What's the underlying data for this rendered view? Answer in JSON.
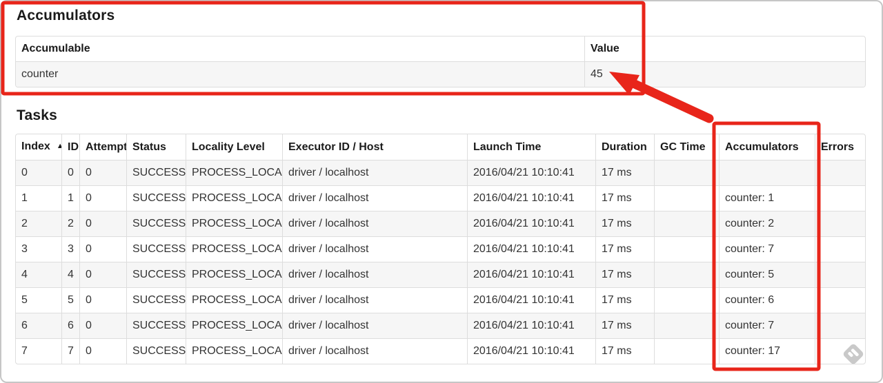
{
  "accumulators_section": {
    "title": "Accumulators",
    "table": {
      "headers": [
        "Accumulable",
        "Value"
      ],
      "rows": [
        {
          "accumulable": "counter",
          "value": "45"
        }
      ]
    }
  },
  "tasks_section": {
    "title": "Tasks",
    "table": {
      "headers": [
        "Index",
        "ID",
        "Attempt",
        "Status",
        "Locality Level",
        "Executor ID / Host",
        "Launch Time",
        "Duration",
        "GC Time",
        "Accumulators",
        "Errors"
      ],
      "sort_column": "Index",
      "sort_icon": "▲",
      "rows": [
        {
          "index": "0",
          "id": "0",
          "attempt": "0",
          "status": "SUCCESS",
          "locality_level": "PROCESS_LOCAL",
          "executor_id_host": "driver / localhost",
          "launch_time": "2016/04/21 10:10:41",
          "duration": "17 ms",
          "gc_time": "",
          "accumulators": "",
          "errors": ""
        },
        {
          "index": "1",
          "id": "1",
          "attempt": "0",
          "status": "SUCCESS",
          "locality_level": "PROCESS_LOCAL",
          "executor_id_host": "driver / localhost",
          "launch_time": "2016/04/21 10:10:41",
          "duration": "17 ms",
          "gc_time": "",
          "accumulators": "counter: 1",
          "errors": ""
        },
        {
          "index": "2",
          "id": "2",
          "attempt": "0",
          "status": "SUCCESS",
          "locality_level": "PROCESS_LOCAL",
          "executor_id_host": "driver / localhost",
          "launch_time": "2016/04/21 10:10:41",
          "duration": "17 ms",
          "gc_time": "",
          "accumulators": "counter: 2",
          "errors": ""
        },
        {
          "index": "3",
          "id": "3",
          "attempt": "0",
          "status": "SUCCESS",
          "locality_level": "PROCESS_LOCAL",
          "executor_id_host": "driver / localhost",
          "launch_time": "2016/04/21 10:10:41",
          "duration": "17 ms",
          "gc_time": "",
          "accumulators": "counter: 7",
          "errors": ""
        },
        {
          "index": "4",
          "id": "4",
          "attempt": "0",
          "status": "SUCCESS",
          "locality_level": "PROCESS_LOCAL",
          "executor_id_host": "driver / localhost",
          "launch_time": "2016/04/21 10:10:41",
          "duration": "17 ms",
          "gc_time": "",
          "accumulators": "counter: 5",
          "errors": ""
        },
        {
          "index": "5",
          "id": "5",
          "attempt": "0",
          "status": "SUCCESS",
          "locality_level": "PROCESS_LOCAL",
          "executor_id_host": "driver / localhost",
          "launch_time": "2016/04/21 10:10:41",
          "duration": "17 ms",
          "gc_time": "",
          "accumulators": "counter: 6",
          "errors": ""
        },
        {
          "index": "6",
          "id": "6",
          "attempt": "0",
          "status": "SUCCESS",
          "locality_level": "PROCESS_LOCAL",
          "executor_id_host": "driver / localhost",
          "launch_time": "2016/04/21 10:10:41",
          "duration": "17 ms",
          "gc_time": "",
          "accumulators": "counter: 7",
          "errors": ""
        },
        {
          "index": "7",
          "id": "7",
          "attempt": "0",
          "status": "SUCCESS",
          "locality_level": "PROCESS_LOCAL",
          "executor_id_host": "driver / localhost",
          "launch_time": "2016/04/21 10:10:41",
          "duration": "17 ms",
          "gc_time": "",
          "accumulators": "counter: 17",
          "errors": ""
        }
      ]
    }
  },
  "annotations": {
    "color": "#e8251a",
    "arrow_target_value": "45"
  },
  "watermark": {
    "icon": "feedly-logo-icon",
    "color": "#c9c9c9"
  }
}
